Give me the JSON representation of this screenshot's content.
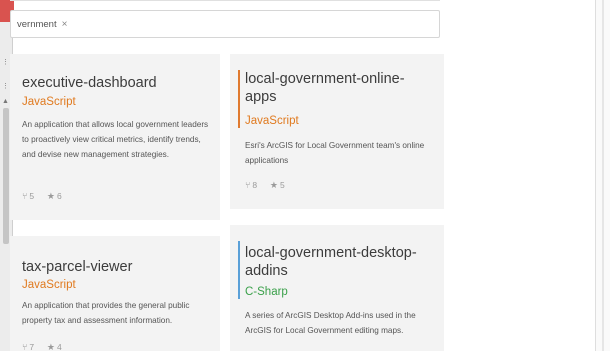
{
  "filter": {
    "chip_label": "vernment",
    "remove_symbol": "×"
  },
  "cards": [
    {
      "title": "executive-dashboard",
      "language": "JavaScript",
      "description": "An application that allows local government leaders to proactively view critical metrics, identify trends, and devise new management strategies.",
      "forks": "5",
      "stars": "6"
    },
    {
      "title": "local-government-online-\napps",
      "language": "JavaScript",
      "description": "Esri's ArcGIS for Local Government team's online applications",
      "forks": "8",
      "stars": "5"
    },
    {
      "title": "tax-parcel-viewer",
      "language": "JavaScript",
      "description": "An application that provides the general public property tax and assessment information.",
      "forks": "7",
      "stars": "4"
    },
    {
      "title": "local-government-desktop-\naddins",
      "language": "C-Sharp",
      "description": "A series of ArcGIS Desktop Add-ins used in the ArcGIS for Local Government editing maps.",
      "forks": "",
      "stars": ""
    }
  ],
  "icons": {
    "fork": "fork-icon",
    "star": "star-icon"
  },
  "colors": {
    "javascript": "#e07a1f",
    "csharp": "#3aa04a",
    "accent_js": "#e07a2f",
    "accent_cs": "#5aa0d8",
    "close_button": "#d9534f"
  }
}
